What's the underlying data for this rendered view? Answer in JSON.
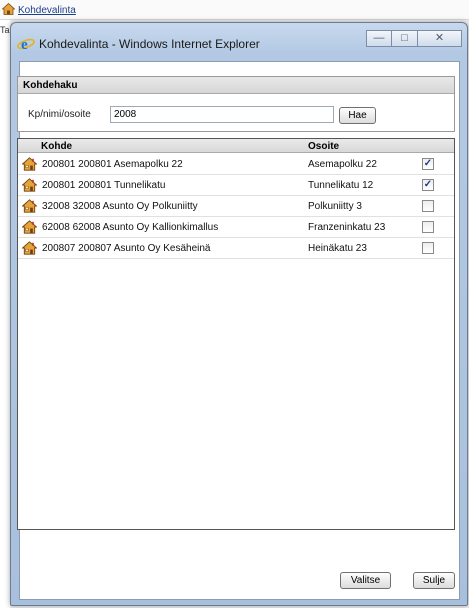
{
  "background": {
    "link_text": "Kohdevalinta",
    "left_text": "Ta"
  },
  "window": {
    "title": "Kohdevalinta - Windows Internet Explorer",
    "controls": {
      "minimize": "—",
      "maximize": "□",
      "close": "✕"
    }
  },
  "search": {
    "panel_title": "Kohdehaku",
    "label": "Kp/nimi/osoite",
    "value": "2008",
    "button_label": "Hae"
  },
  "results": {
    "col_kohde": "Kohde",
    "col_osoite": "Osoite",
    "rows": [
      {
        "kohde": "200801  200801 Asemapolku 22",
        "osoite": "Asemapolku 22",
        "checked": true
      },
      {
        "kohde": "200801  200801 Tunnelikatu",
        "osoite": "Tunnelikatu 12",
        "checked": true
      },
      {
        "kohde": "32008  32008 Asunto Oy Polkuniitty",
        "osoite": "Polkuniitty 3",
        "checked": false
      },
      {
        "kohde": "62008  62008 Asunto Oy Kallionkimallus",
        "osoite": "Franzeninkatu 23",
        "checked": false
      },
      {
        "kohde": "200807  200807 Asunto Oy Kesäheinä",
        "osoite": "Heinäkatu 23",
        "checked": false
      }
    ]
  },
  "buttons": {
    "valitse": "Valitse",
    "sulje": "Sulje"
  },
  "icons": {
    "row_icon": "house-icon",
    "browser_icon": "internet-explorer-icon"
  }
}
